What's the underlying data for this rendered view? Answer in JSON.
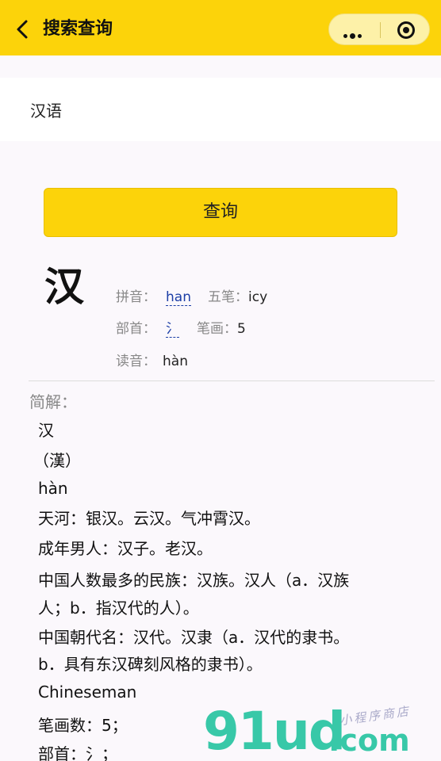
{
  "navbar": {
    "title": "搜索查询",
    "back_icon": "chevron-left-icon",
    "more_icon": "more-dots-icon",
    "close_icon": "target-circle-icon",
    "background": "#fcd30a"
  },
  "search": {
    "value": "汉语"
  },
  "query_button": {
    "label": "查询"
  },
  "result": {
    "character": "汉",
    "pinyin_label": "拼音：",
    "pinyin": "han",
    "wubi_label": "五笔：",
    "wubi": "icy",
    "radical_label": "部首：",
    "radical": "氵",
    "strokes_label": "笔画：",
    "strokes": "5",
    "reading_label": "读音：",
    "reading": "hàn"
  },
  "brief": {
    "label": "简解：",
    "lines": [
      "汉",
      "（漢）",
      "hàn",
      "天河：银汉。云汉。气冲霄汉。",
      "成年男人：汉子。老汉。",
      "中国人数最多的民族：汉族。汉人（a．汉族",
      "人；b．指汉代的人）。",
      "中国朝代名：汉代。汉隶（a．汉代的隶书。",
      "b．具有东汉碑刻风格的隶书）。",
      "Chineseman",
      "笔画数：5；",
      "部首：氵；"
    ]
  },
  "watermark": {
    "brand": "91ud",
    "domain": ".com",
    "sub": "小程序商店"
  }
}
